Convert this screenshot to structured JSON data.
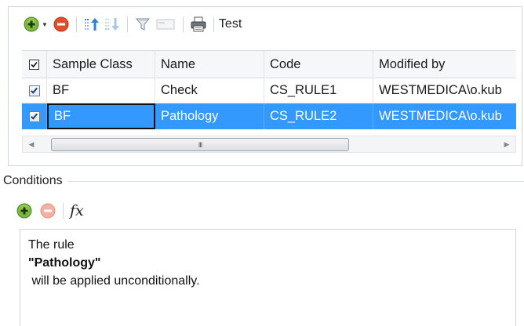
{
  "toolbar": {
    "icons": [
      "add-icon",
      "remove-icon",
      "move-up-icon",
      "move-down-icon",
      "filter-icon",
      "field-icon",
      "print-icon"
    ],
    "test_label": "Test"
  },
  "grid": {
    "columns": [
      "Sample Class",
      "Name",
      "Code",
      "Modified by"
    ],
    "rows": [
      {
        "checked": true,
        "sample_class": "BF",
        "name": "Check",
        "code": "CS_RULE1",
        "modified_by": "WESTMEDICA\\o.kub"
      },
      {
        "checked": true,
        "sample_class": "BF",
        "name": "Pathology",
        "code": "CS_RULE2",
        "modified_by": "WESTMEDICA\\o.kub",
        "selected": true
      }
    ],
    "scroll_thumb_glyph": "III"
  },
  "conditions": {
    "title": "Conditions",
    "fx_label": "fx",
    "rule_line1": "The rule",
    "rule_line2": "\"Pathology\"",
    "rule_line3": " will be applied unconditionally."
  },
  "colors": {
    "selection": "#3399ff",
    "add_green": "#7ab640",
    "remove_red": "#e2502b",
    "arrow_blue": "#2f80d8"
  }
}
